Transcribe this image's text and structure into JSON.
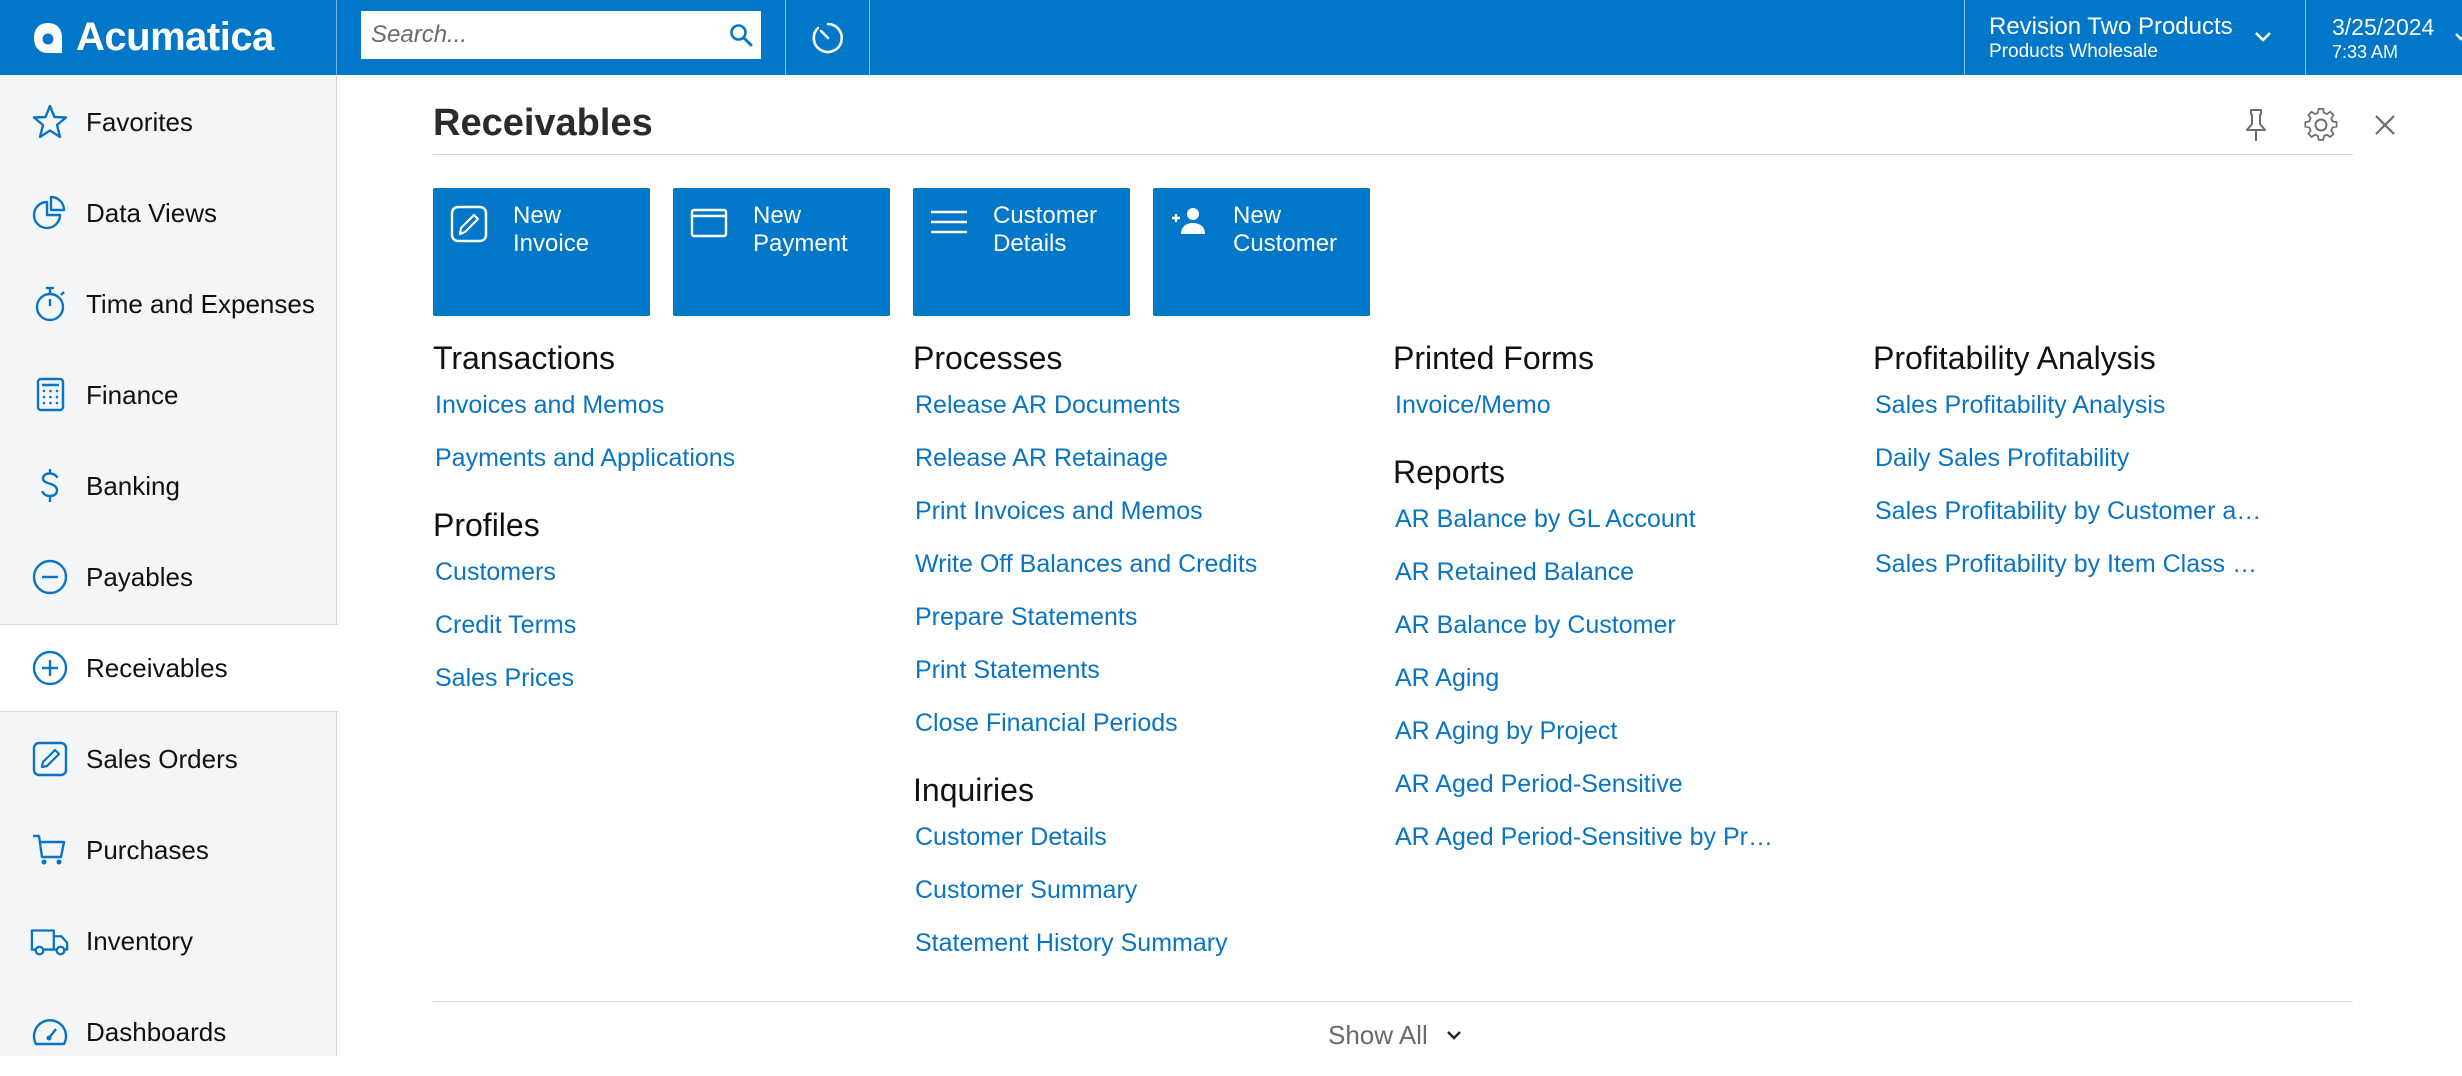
{
  "header": {
    "brand": "Acumatica",
    "search_placeholder": "Search...",
    "company": {
      "name": "Revision Two Products",
      "branch": "Products Wholesale"
    },
    "date": "3/25/2024",
    "time": "7:33 AM"
  },
  "sidebar": {
    "items": [
      {
        "label": "Favorites",
        "icon": "star-icon"
      },
      {
        "label": "Data Views",
        "icon": "pie-chart-icon"
      },
      {
        "label": "Time and Expenses",
        "icon": "stopwatch-icon"
      },
      {
        "label": "Finance",
        "icon": "calculator-icon"
      },
      {
        "label": "Banking",
        "icon": "dollar-icon"
      },
      {
        "label": "Payables",
        "icon": "minus-circle-icon"
      },
      {
        "label": "Receivables",
        "icon": "plus-circle-icon",
        "active": true
      },
      {
        "label": "Sales Orders",
        "icon": "edit-icon"
      },
      {
        "label": "Purchases",
        "icon": "cart-icon"
      },
      {
        "label": "Inventory",
        "icon": "truck-icon"
      },
      {
        "label": "Dashboards",
        "icon": "gauge-icon"
      }
    ]
  },
  "main": {
    "title": "Receivables",
    "tiles": [
      {
        "label": "New\nInvoice",
        "icon": "edit-icon"
      },
      {
        "label": "New\nPayment",
        "icon": "card-icon"
      },
      {
        "label": "Customer\nDetails",
        "icon": "list-icon"
      },
      {
        "label": "New\nCustomer",
        "icon": "add-user-icon"
      }
    ],
    "columns": [
      {
        "groups": [
          {
            "heading": "Transactions",
            "links": [
              "Invoices and Memos",
              "Payments and Applications"
            ]
          },
          {
            "heading": "Profiles",
            "links": [
              "Customers",
              "Credit Terms",
              "Sales Prices"
            ]
          }
        ]
      },
      {
        "groups": [
          {
            "heading": "Processes",
            "links": [
              "Release AR Documents",
              "Release AR Retainage",
              "Print Invoices and Memos",
              "Write Off Balances and Credits",
              "Prepare Statements",
              "Print Statements",
              "Close Financial Periods"
            ]
          },
          {
            "heading": "Inquiries",
            "links": [
              "Customer Details",
              "Customer Summary",
              "Statement History Summary"
            ]
          }
        ]
      },
      {
        "groups": [
          {
            "heading": "Printed Forms",
            "links": [
              "Invoice/Memo"
            ]
          },
          {
            "heading": "Reports",
            "links": [
              "AR Balance by GL Account",
              "AR Retained Balance",
              "AR Balance by Customer",
              "AR Aging",
              "AR Aging by Project",
              "AR Aged Period-Sensitive",
              "AR Aged Period-Sensitive by Pr…"
            ]
          }
        ]
      },
      {
        "groups": [
          {
            "heading": "Profitability Analysis",
            "links": [
              "Sales Profitability Analysis",
              "Daily Sales Profitability",
              "Sales Profitability by Customer a…",
              "Sales Profitability by Item Class …"
            ]
          }
        ]
      }
    ],
    "show_all": "Show All"
  },
  "colors": {
    "brand_blue": "#0077c8",
    "link_blue": "#0a74c4",
    "sidebar_bg": "#f3f5f7"
  }
}
